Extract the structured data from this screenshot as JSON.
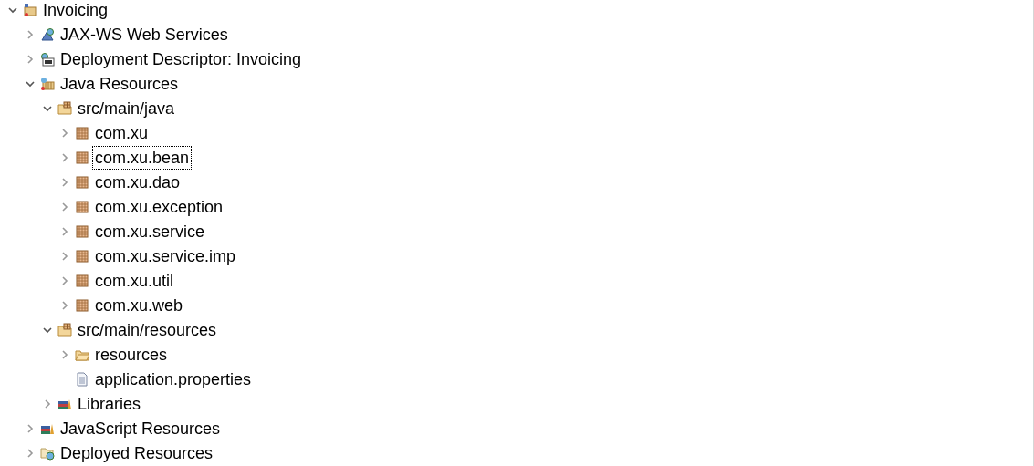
{
  "tree": [
    {
      "label": "Invoicing",
      "kind": "project",
      "expanded": true,
      "focused": false,
      "children": [
        {
          "label": "JAX-WS Web Services",
          "kind": "webservice",
          "expanded": false,
          "focused": false
        },
        {
          "label": "Deployment Descriptor: Invoicing",
          "kind": "descriptor",
          "expanded": false,
          "focused": false
        },
        {
          "label": "Java Resources",
          "kind": "javares",
          "expanded": true,
          "focused": false,
          "children": [
            {
              "label": "src/main/java",
              "kind": "srcfolder",
              "expanded": true,
              "focused": false,
              "children": [
                {
                  "label": "com.xu",
                  "kind": "package",
                  "expanded": false,
                  "focused": false
                },
                {
                  "label": "com.xu.bean",
                  "kind": "package",
                  "expanded": false,
                  "focused": true
                },
                {
                  "label": "com.xu.dao",
                  "kind": "package",
                  "expanded": false,
                  "focused": false
                },
                {
                  "label": "com.xu.exception",
                  "kind": "package",
                  "expanded": false,
                  "focused": false
                },
                {
                  "label": "com.xu.service",
                  "kind": "package",
                  "expanded": false,
                  "focused": false
                },
                {
                  "label": "com.xu.service.imp",
                  "kind": "package",
                  "expanded": false,
                  "focused": false
                },
                {
                  "label": "com.xu.util",
                  "kind": "package",
                  "expanded": false,
                  "focused": false
                },
                {
                  "label": "com.xu.web",
                  "kind": "package",
                  "expanded": false,
                  "focused": false
                }
              ]
            },
            {
              "label": "src/main/resources",
              "kind": "srcfolder",
              "expanded": true,
              "focused": false,
              "children": [
                {
                  "label": "resources",
                  "kind": "folder",
                  "expanded": false,
                  "focused": false
                },
                {
                  "label": "application.properties",
                  "kind": "file",
                  "focused": false
                }
              ]
            },
            {
              "label": "Libraries",
              "kind": "library",
              "expanded": false,
              "focused": false
            }
          ]
        },
        {
          "label": "JavaScript Resources",
          "kind": "library",
          "expanded": false,
          "focused": false
        },
        {
          "label": "Deployed Resources",
          "kind": "deployed",
          "expanded": false,
          "focused": false
        }
      ]
    }
  ]
}
